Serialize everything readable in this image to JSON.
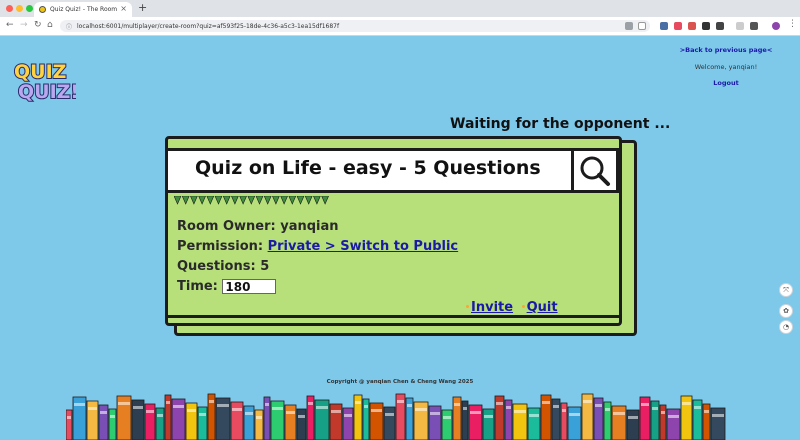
{
  "browser": {
    "tab_title": "Quiz Quiz! - The Room",
    "new_tab": "+",
    "close_tab": "×",
    "url": "localhost:6001/multiplayer/create-room?quiz=af593f25-18de-4c36-a5c3-1ea15df1687f"
  },
  "header": {
    "logo_top": "QUIZ",
    "logo_bottom": "QUIZ!",
    "back_link": ">Back to previous page<",
    "welcome": "Welcome, yanqian!",
    "logout": "Logout"
  },
  "room": {
    "status": "Waiting for the opponent ...",
    "quiz_title": "Quiz on Life - easy - 5 Questions",
    "owner_label": "Room Owner:",
    "owner": "yanqian",
    "permission_label": "Permission:",
    "permission_link": "Private > Switch to Public",
    "questions_label": "Questions:",
    "questions": "5",
    "time_label": "Time:",
    "time_value": "180",
    "invite": "Invite",
    "quit": "Quit"
  },
  "footer": {
    "copyright": "Copyright @ yanqian Chen & Cheng Wang 2025"
  },
  "colors": {
    "page_bg": "#7ec8ea",
    "card_bg": "#b8e07a",
    "link": "#1a1aa6",
    "triangle": "#3f8f3f"
  }
}
